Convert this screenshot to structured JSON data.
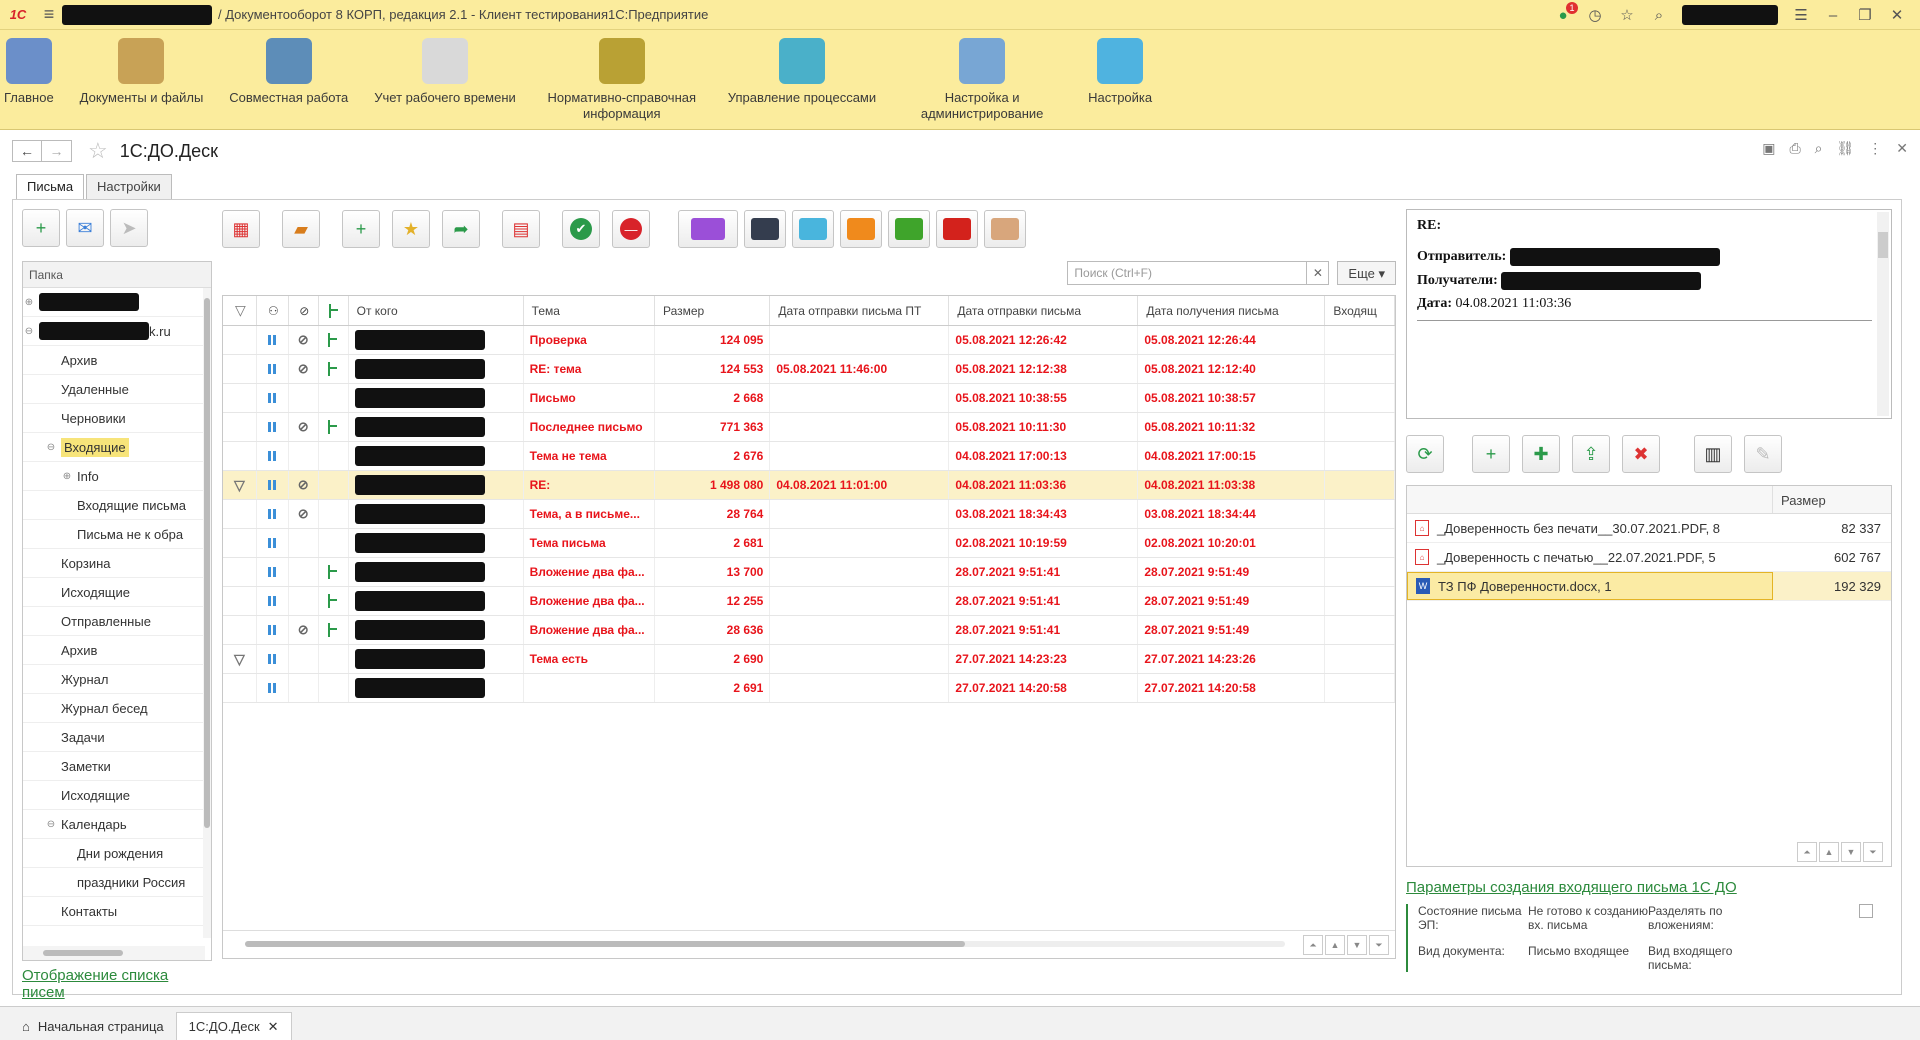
{
  "app": {
    "title": "/ Документооборот 8 КОРП, редакция 2.1  -  Клиент тестирования1С:Предприятие",
    "badge_count": "1"
  },
  "sections": [
    {
      "label": "Главное",
      "color": "#6b8fc9"
    },
    {
      "label": "Документы и файлы",
      "color": "#c8a256"
    },
    {
      "label": "Совместная работа",
      "color": "#5d8db8"
    },
    {
      "label": "Учет рабочего времени",
      "color": "#d9d9d9"
    },
    {
      "label": "Нормативно-справочная информация",
      "color": "#b9a134"
    },
    {
      "label": "Управление процессами",
      "color": "#4ab0c9"
    },
    {
      "label": "Настройка и администрирование",
      "color": "#78a6d4"
    },
    {
      "label": "Настройка",
      "color": "#4fb3e0"
    }
  ],
  "page": {
    "title": "1С:ДО.Деск"
  },
  "tabs": [
    "Письма",
    "Настройки"
  ],
  "tree": {
    "header": "Папка",
    "root2_suffix": "k.ru",
    "items": [
      {
        "label": "Архив",
        "level": 1
      },
      {
        "label": "Удаленные",
        "level": 1
      },
      {
        "label": "Черновики",
        "level": 1
      },
      {
        "label": "Входящие",
        "level": 1,
        "selected": true,
        "expander": "⊖"
      },
      {
        "label": "Info",
        "level": 2,
        "expander": "⊕"
      },
      {
        "label": "Входящие письма",
        "level": 2
      },
      {
        "label": "Письма не к обра",
        "level": 2
      },
      {
        "label": "Корзина",
        "level": 1
      },
      {
        "label": "Исходящие",
        "level": 1
      },
      {
        "label": "Отправленные",
        "level": 1
      },
      {
        "label": "Архив",
        "level": 1
      },
      {
        "label": "Журнал",
        "level": 1
      },
      {
        "label": "Журнал бесед",
        "level": 1
      },
      {
        "label": "Задачи",
        "level": 1
      },
      {
        "label": "Заметки",
        "level": 1
      },
      {
        "label": "Исходящие",
        "level": 1
      },
      {
        "label": "Календарь",
        "level": 1,
        "expander": "⊖"
      },
      {
        "label": "Дни рождения",
        "level": 2
      },
      {
        "label": "праздники Россия",
        "level": 2
      },
      {
        "label": "Контакты",
        "level": 1
      }
    ]
  },
  "left_link": "Отображение списка писем",
  "search": {
    "placeholder": "Поиск (Ctrl+F)",
    "more": "Еще"
  },
  "folder_colors": [
    "#9b4fd8",
    "#343d4e",
    "#49b5dd",
    "#f08a1c",
    "#3fa42b",
    "#d3221c",
    "#d8a67c"
  ],
  "columns": [
    "От кого",
    "Тема",
    "Размер",
    "Дата отправки письма ПТ",
    "Дата отправки письма",
    "Дата получения письма",
    "Входящ"
  ],
  "rows": [
    {
      "subject": "Проверка",
      "size": "124 095",
      "sent_pt": "",
      "sent": "05.08.2021 12:26:42",
      "received": "05.08.2021 12:26:44",
      "clip": true,
      "tree": true,
      "flag": false
    },
    {
      "subject": "RE: тема",
      "size": "124 553",
      "sent_pt": "05.08.2021 11:46:00",
      "sent": "05.08.2021 12:12:38",
      "received": "05.08.2021 12:12:40",
      "clip": true,
      "tree": true,
      "flag": false
    },
    {
      "subject": "Письмо",
      "size": "2 668",
      "sent_pt": "",
      "sent": "05.08.2021 10:38:55",
      "received": "05.08.2021 10:38:57",
      "clip": false,
      "tree": false,
      "flag": false
    },
    {
      "subject": "Последнее письмо",
      "size": "771 363",
      "sent_pt": "",
      "sent": "05.08.2021 10:11:30",
      "received": "05.08.2021 10:11:32",
      "clip": true,
      "tree": true,
      "flag": false
    },
    {
      "subject": "Тема не тема",
      "size": "2 676",
      "sent_pt": "",
      "sent": "04.08.2021 17:00:13",
      "received": "04.08.2021 17:00:15",
      "clip": false,
      "tree": false,
      "flag": false
    },
    {
      "subject": "RE:",
      "size": "1 498 080",
      "sent_pt": "04.08.2021 11:01:00",
      "sent": "04.08.2021 11:03:36",
      "received": "04.08.2021 11:03:38",
      "clip": true,
      "tree": false,
      "flag": true,
      "selected": true
    },
    {
      "subject": "Тема, а в письме...",
      "size": "28 764",
      "sent_pt": "",
      "sent": "03.08.2021 18:34:43",
      "received": "03.08.2021 18:34:44",
      "clip": true,
      "tree": false,
      "flag": false
    },
    {
      "subject": "Тема письма",
      "size": "2 681",
      "sent_pt": "",
      "sent": "02.08.2021 10:19:59",
      "received": "02.08.2021 10:20:01",
      "clip": false,
      "tree": false,
      "flag": false
    },
    {
      "subject": "Вложение два фа...",
      "size": "13 700",
      "sent_pt": "",
      "sent": "28.07.2021 9:51:41",
      "received": "28.07.2021 9:51:49",
      "clip": false,
      "tree": true,
      "flag": false
    },
    {
      "subject": "Вложение два фа...",
      "size": "12 255",
      "sent_pt": "",
      "sent": "28.07.2021 9:51:41",
      "received": "28.07.2021 9:51:49",
      "clip": false,
      "tree": true,
      "flag": false
    },
    {
      "subject": "Вложение два фа...",
      "size": "28 636",
      "sent_pt": "",
      "sent": "28.07.2021 9:51:41",
      "received": "28.07.2021 9:51:49",
      "clip": true,
      "tree": true,
      "flag": false
    },
    {
      "subject": "Тема есть",
      "size": "2 690",
      "sent_pt": "",
      "sent": "27.07.2021 14:23:23",
      "received": "27.07.2021 14:23:26",
      "clip": false,
      "tree": false,
      "flag": true
    },
    {
      "subject": "",
      "size": "2 691",
      "sent_pt": "",
      "sent": "27.07.2021 14:20:58",
      "received": "27.07.2021 14:20:58",
      "clip": false,
      "tree": false,
      "flag": false
    }
  ],
  "preview": {
    "subject": "RE:",
    "sender_label": "Отправитель:",
    "recipients_label": "Получатели:",
    "date_label": "Дата:",
    "date": "04.08.2021 11:03:36"
  },
  "attachments": {
    "size_header": "Размер",
    "items": [
      {
        "name": "_Доверенность без печати__30.07.2021.PDF, 8",
        "size": "82 337",
        "type": "pdf"
      },
      {
        "name": "_Доверенность с печатью__22.07.2021.PDF, 5",
        "size": "602 767",
        "type": "pdf"
      },
      {
        "name": "ТЗ ПФ Доверенности.docx, 1",
        "size": "192 329",
        "type": "doc",
        "selected": true
      }
    ]
  },
  "params": {
    "link": "Параметры создания входящего письма 1С ДО",
    "state_label": "Состояние письма ЭП:",
    "state_value": "Не готово к созданию вх. письма",
    "split_label": "Разделять по вложениям:",
    "doctype_label": "Вид документа:",
    "doctype_value": "Письмо входящее",
    "incoming_type_label": "Вид входящего письма:"
  },
  "bottom_tabs": [
    "Начальная страница",
    "1С:ДО.Деск"
  ]
}
